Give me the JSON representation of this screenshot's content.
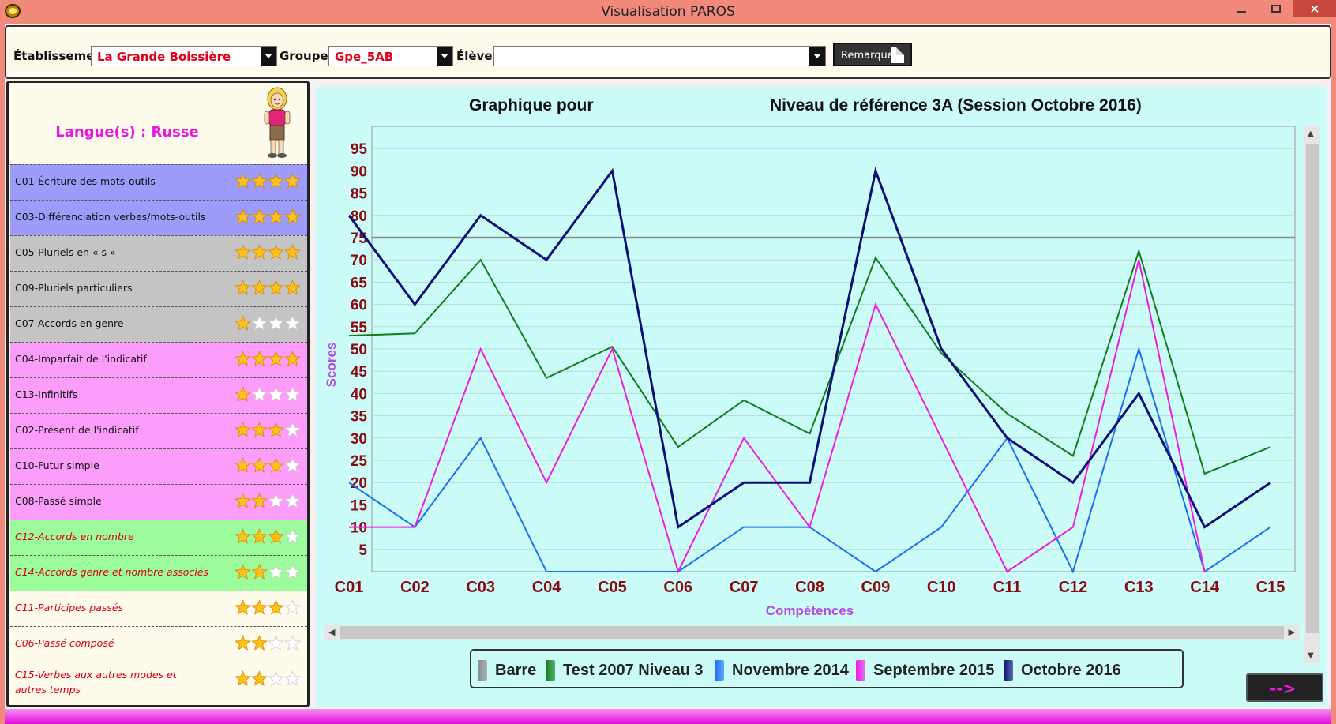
{
  "window": {
    "title": "Visualisation PAROS",
    "close_label": "✕"
  },
  "toolbar": {
    "etablissement_label": "Établissement",
    "etablissement_value": "La Grande Boissière",
    "groupe_label": "Groupe",
    "groupe_value": "Gpe_5AB",
    "eleve_label": "Élève",
    "eleve_value": "",
    "remarque_label": "Remarque"
  },
  "left_panel": {
    "language_title": "Langue(s) : Russe",
    "skills": [
      {
        "name": "C01-Écriture des mots-outils",
        "stars": 4,
        "bg": "#9d9cfb",
        "italic": false
      },
      {
        "name": "C03-Différenciation verbes/mots-outils",
        "stars": 4,
        "bg": "#9d9cfb",
        "italic": false
      },
      {
        "name": "C05-Pluriels en « s »",
        "stars": 4,
        "bg": "#c4c4c4",
        "italic": false
      },
      {
        "name": "C09-Pluriels particuliers",
        "stars": 4,
        "bg": "#c4c4c4",
        "italic": false
      },
      {
        "name": "C07-Accords en genre",
        "stars": 1,
        "bg": "#c4c4c4",
        "italic": false
      },
      {
        "name": "C04-Imparfait de l'indicatif",
        "stars": 4,
        "bg": "#fc9cfb",
        "italic": false
      },
      {
        "name": "C13-Infinitifs",
        "stars": 1,
        "bg": "#fc9cfb",
        "italic": false
      },
      {
        "name": "C02-Présent de l'indicatif",
        "stars": 3,
        "bg": "#fc9cfb",
        "italic": false
      },
      {
        "name": "C10-Futur simple",
        "stars": 3,
        "bg": "#fc9cfb",
        "italic": false
      },
      {
        "name": "C08-Passé simple",
        "stars": 2,
        "bg": "#fc9cfb",
        "italic": false
      },
      {
        "name": "C12-Accords en nombre",
        "stars": 3,
        "bg": "#9cfc9c",
        "italic": true
      },
      {
        "name": "C14-Accords genre et nombre associés",
        "stars": 2,
        "bg": "#9cfc9c",
        "italic": true
      },
      {
        "name": "C11-Participes passés",
        "stars": 3,
        "bg": "#fffbec",
        "italic": true
      },
      {
        "name": "C06-Passé composé",
        "stars": 2,
        "bg": "#fffbec",
        "italic": true
      },
      {
        "name": "C15-Verbes aux autres modes et autres temps",
        "stars": 2,
        "bg": "#fffbec",
        "italic": true
      }
    ]
  },
  "chart": {
    "title_left": "Graphique pour",
    "title_right": "Niveau de référence 3A (Session Octobre 2016)"
  },
  "chart_data": {
    "type": "line",
    "title": "Graphique pour    Niveau de référence 3A (Session Octobre 2016)",
    "xlabel": "Compétences",
    "ylabel": "Scores",
    "ylim": [
      0,
      100
    ],
    "yticks": [
      5,
      10,
      15,
      20,
      25,
      30,
      35,
      40,
      45,
      50,
      55,
      60,
      65,
      70,
      75,
      80,
      85,
      90,
      95
    ],
    "grid": true,
    "legend_position": "bottom",
    "categories": [
      "C01",
      "C02",
      "C03",
      "C04",
      "C05",
      "C06",
      "C07",
      "C08",
      "C09",
      "C10",
      "C11",
      "C12",
      "C13",
      "C14",
      "C15"
    ],
    "series": [
      {
        "name": "Barre",
        "color": "#8a8a8a",
        "values": [
          75,
          75,
          75,
          75,
          75,
          75,
          75,
          75,
          75,
          75,
          75,
          75,
          75,
          75,
          75
        ]
      },
      {
        "name": "Test 2007 Niveau 3",
        "color": "#0f7d1a",
        "values": [
          53,
          53.5,
          70,
          43.5,
          50.5,
          28,
          38.5,
          31,
          70.5,
          49,
          35.5,
          26,
          72,
          22,
          28
        ]
      },
      {
        "name": "Novembre 2014",
        "color": "#1b6ff5",
        "values": [
          20,
          10,
          30,
          0,
          0,
          0,
          10,
          10,
          0,
          10,
          30,
          0,
          50,
          0,
          10
        ]
      },
      {
        "name": "Septembre 2015",
        "color": "#f01ae6",
        "values": [
          10,
          10,
          50,
          20,
          50,
          0,
          30,
          10,
          60,
          30,
          0,
          10,
          70,
          0,
          null
        ]
      },
      {
        "name": "Octobre 2016",
        "color": "#0c0f78",
        "values": [
          80,
          60,
          80,
          70,
          90,
          10,
          20,
          20,
          90,
          50,
          30,
          20,
          40,
          10,
          20
        ]
      }
    ]
  },
  "next_button": {
    "label": "-->"
  }
}
